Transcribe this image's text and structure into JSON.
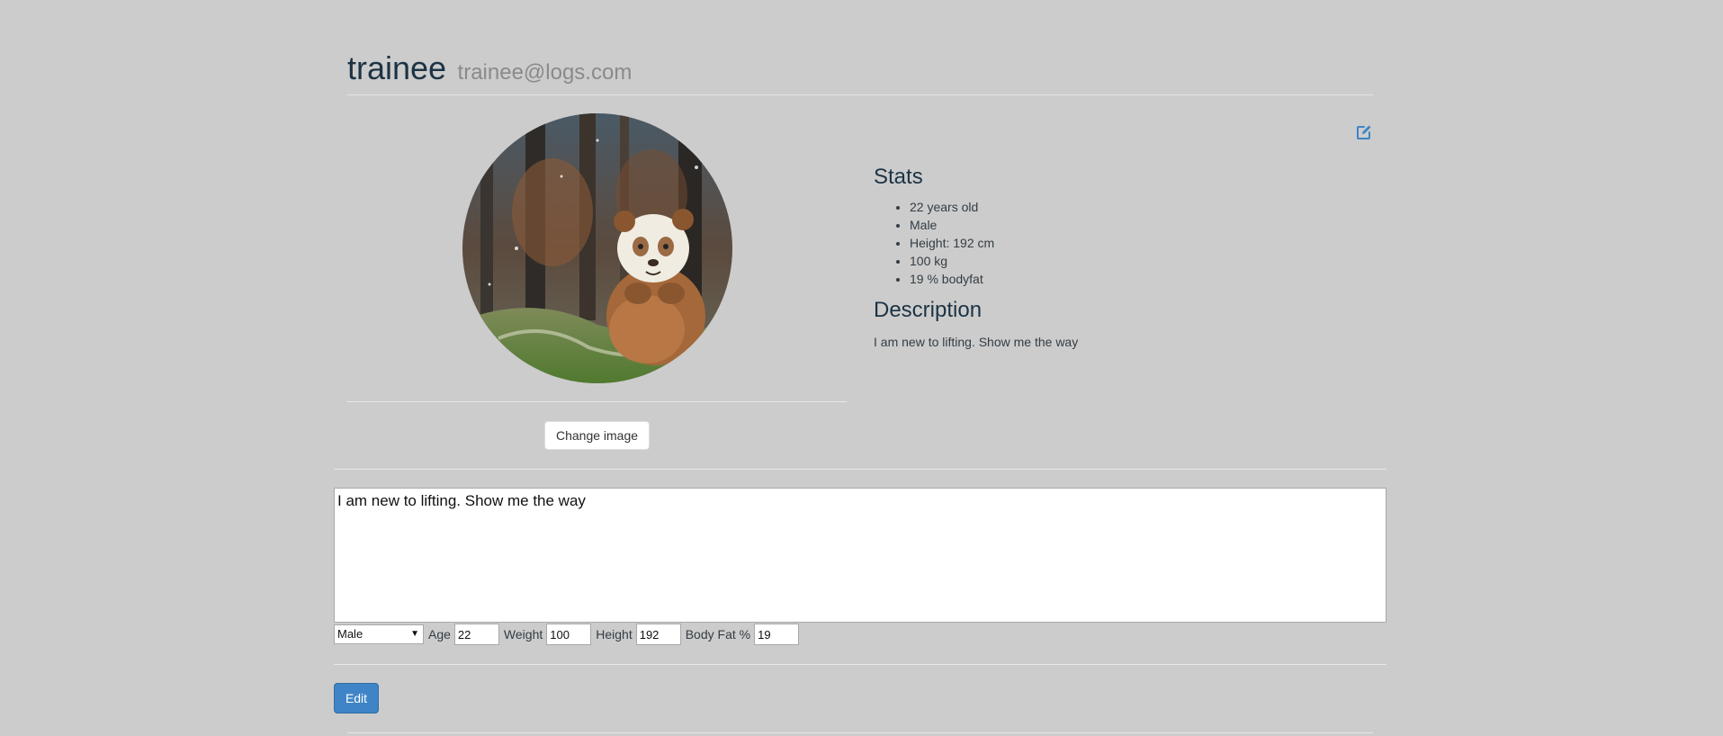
{
  "profile": {
    "username": "trainee",
    "email": "trainee@logs.com"
  },
  "avatar": {
    "alt": "panda-photo"
  },
  "buttons": {
    "change_image": "Change image",
    "edit": "Edit"
  },
  "stats": {
    "title": "Stats",
    "items": [
      "22 years old",
      "Male",
      "Height: 192 cm",
      "100 kg",
      "19 % bodyfat"
    ]
  },
  "description": {
    "title": "Description",
    "text": "I am new to lifting. Show me the way"
  },
  "form": {
    "description_value": "I am new to lifting. Show me the way",
    "gender_value": "Male",
    "age_label": "Age",
    "age_value": "22",
    "weight_label": "Weight",
    "weight_value": "100",
    "height_label": "Height",
    "height_value": "192",
    "bodyfat_label": "Body Fat %",
    "bodyfat_value": "19"
  },
  "icons": {
    "edit": "edit-icon",
    "dropdown": "chevron-down-icon"
  },
  "colors": {
    "background": "#cccccc",
    "accent": "#3f84c6",
    "heading": "#1c3344"
  }
}
